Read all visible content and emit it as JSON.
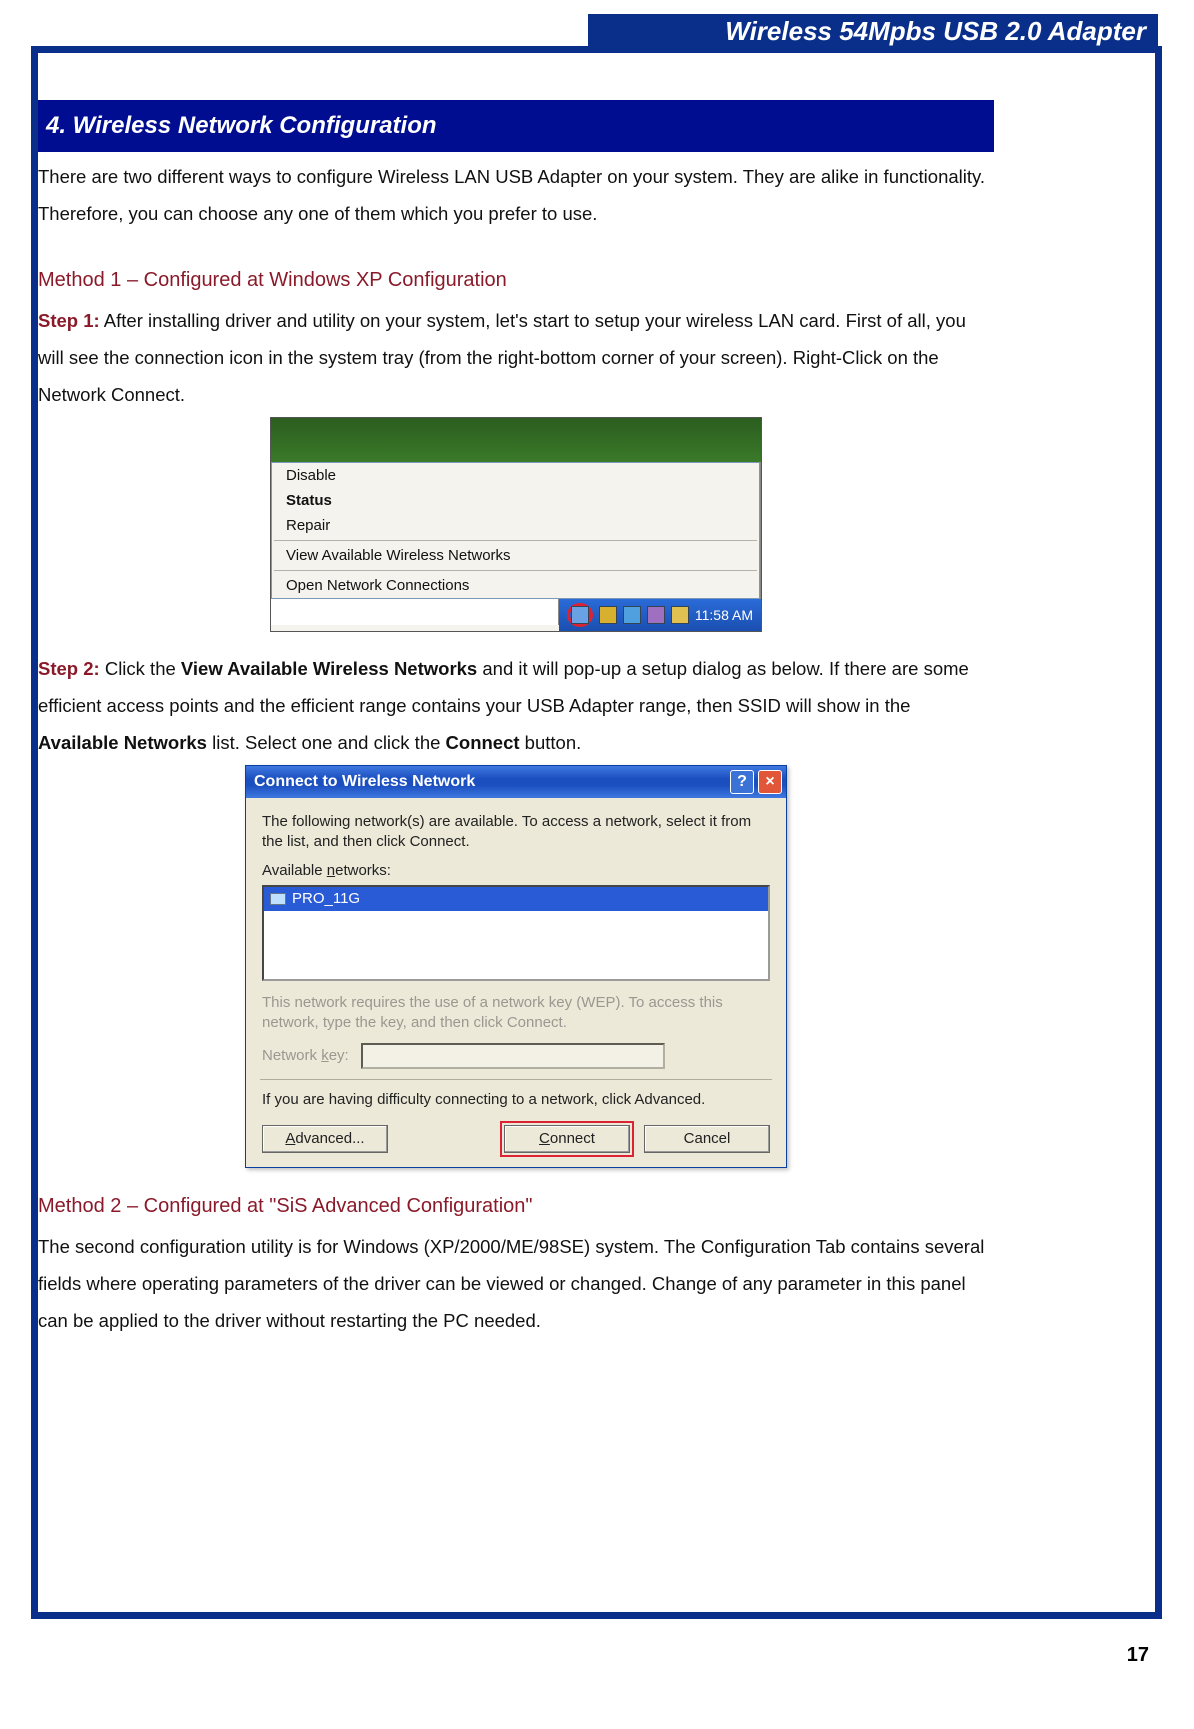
{
  "header": {
    "product": "Wireless 54Mpbs USB 2.0 Adapter"
  },
  "section": {
    "title": "4.  Wireless Network Configuration"
  },
  "intro": "There are two different ways to configure Wireless LAN USB Adapter on your system. They are alike in functionality. Therefore, you can choose any one of them which you prefer to use.",
  "method1": {
    "title": "Method 1 – Configured at Windows XP Configuration",
    "step1_label": "Step 1:",
    "step1_text": " After installing driver and utility on your system, let's start to setup your wireless LAN card. First of all, you will see the connection icon in the system tray (from the right-bottom corner of your screen). Right-Click on the Network Connect.",
    "step2_label": "Step 2:",
    "step2_a": " Click the ",
    "step2_bold1": "View Available Wireless Networks",
    "step2_b": " and it will pop-up a setup dialog as below. If there are some efficient access points and the efficient range contains your USB Adapter range, then SSID will show in the ",
    "step2_bold2": "Available Networks",
    "step2_c": " list. Select one and click the ",
    "step2_bold3": "Connect",
    "step2_d": " button."
  },
  "method2": {
    "title": "Method 2 – Configured at \"SiS Advanced Configuration\"",
    "text": "The second configuration utility is for Windows (XP/2000/ME/98SE) system.   The Configuration Tab contains several fields where operating parameters of the driver can be viewed or changed. Change of any parameter in this panel can be applied to the driver without restarting the PC needed."
  },
  "fig1": {
    "menu": [
      "Disable",
      "Status",
      "Repair",
      "View Available Wireless Networks",
      "Open Network Connections"
    ],
    "bold_index": 1,
    "clock": "11:58 AM"
  },
  "fig2": {
    "title": "Connect to Wireless Network",
    "desc": "The following network(s) are available. To access a network, select it from the list, and then click Connect.",
    "available_label_pre": "Available ",
    "available_label_u": "n",
    "available_label_post": "etworks:",
    "list_item": "PRO_11G",
    "wep_note": "This network requires the use of a network key (WEP). To access this network, type the key, and then click Connect.",
    "key_label_pre": "Network ",
    "key_label_u": "k",
    "key_label_post": "ey:",
    "advice": "If you are having difficulty connecting to a network, click Advanced.",
    "btn_advanced_u": "A",
    "btn_advanced_rest": "dvanced...",
    "btn_connect_u": "C",
    "btn_connect_rest": "onnect",
    "btn_cancel": "Cancel"
  },
  "page_number": "17"
}
